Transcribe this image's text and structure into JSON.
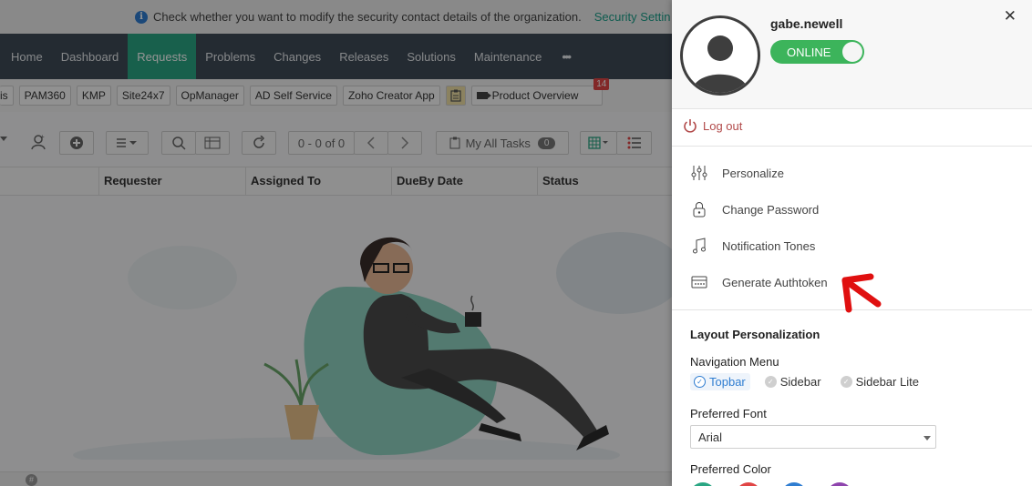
{
  "banner": {
    "message": "Check whether you want to modify the security contact details of the organization.",
    "link": "Security Settin"
  },
  "nav": {
    "tabs": [
      "Home",
      "Dashboard",
      "Requests",
      "Problems",
      "Changes",
      "Releases",
      "Solutions",
      "Maintenance"
    ],
    "active": "Requests",
    "more": "•••"
  },
  "apps": {
    "items": [
      "is",
      "PAM360",
      "KMP",
      "Site24x7",
      "OpManager",
      "AD Self Service",
      "Zoho Creator App"
    ],
    "product_overview": "Product Overview",
    "badge": "14"
  },
  "toolbar": {
    "pager": "0 - 0 of 0",
    "tasks_label": "My All Tasks",
    "tasks_count": "0"
  },
  "table": {
    "columns": [
      "Requester",
      "Assigned To",
      "DueBy Date",
      "Status"
    ]
  },
  "statusbar": {
    "hash": "#"
  },
  "profile": {
    "username": "gabe.newell",
    "status": "ONLINE",
    "close": "✕",
    "logout": "Log out",
    "menu": [
      {
        "label": "Personalize",
        "icon": "sliders-icon"
      },
      {
        "label": "Change Password",
        "icon": "lock-icon"
      },
      {
        "label": "Notification Tones",
        "icon": "music-note-icon"
      },
      {
        "label": "Generate Authtoken",
        "icon": "token-icon"
      }
    ]
  },
  "layout": {
    "title": "Layout Personalization",
    "nav_menu_label": "Navigation Menu",
    "nav_options": [
      "Topbar",
      "Sidebar",
      "Sidebar Lite"
    ],
    "nav_selected": "Topbar",
    "font_label": "Preferred Font",
    "font_value": "Arial",
    "color_label": "Preferred Color",
    "colors": [
      "#2aa683",
      "#e04545",
      "#2f7dd1",
      "#8e44ad"
    ]
  }
}
